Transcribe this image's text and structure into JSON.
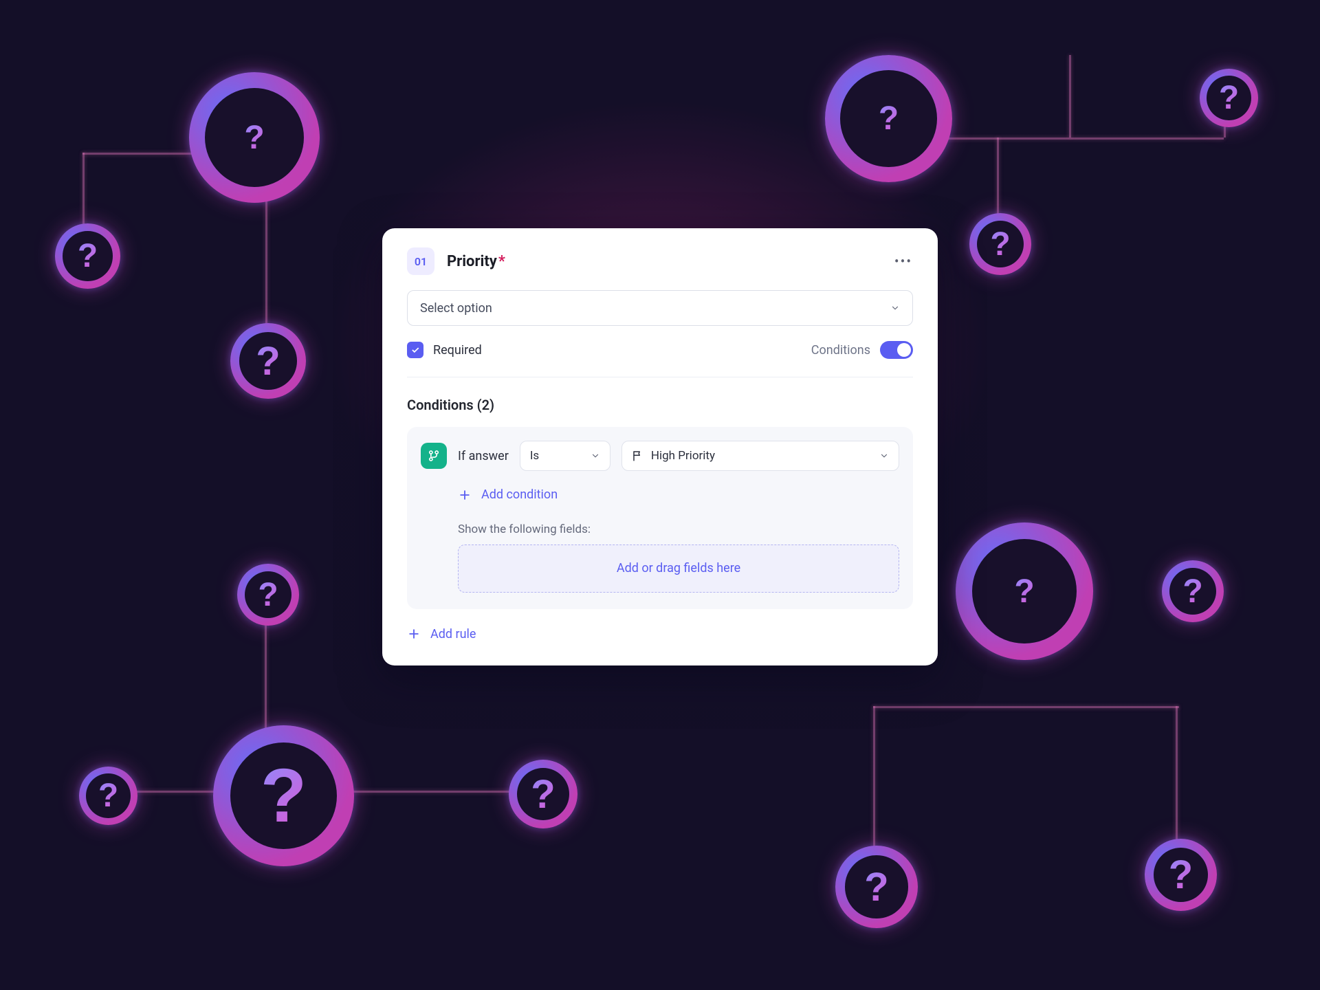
{
  "question": {
    "number": "01",
    "title": "Priority",
    "required_marker": "*",
    "select_placeholder": "Select option",
    "required_label": "Required",
    "required_checked": true,
    "conditions_toggle_label": "Conditions",
    "conditions_on": true
  },
  "conditions": {
    "heading": "Conditions (2)",
    "rule": {
      "if_label": "If answer",
      "operator": "Is",
      "value": "High Priority"
    },
    "add_condition_label": "Add condition",
    "show_fields_label": "Show the following fields:",
    "dropzone_label": "Add or drag fields here",
    "add_rule_label": "Add rule"
  }
}
